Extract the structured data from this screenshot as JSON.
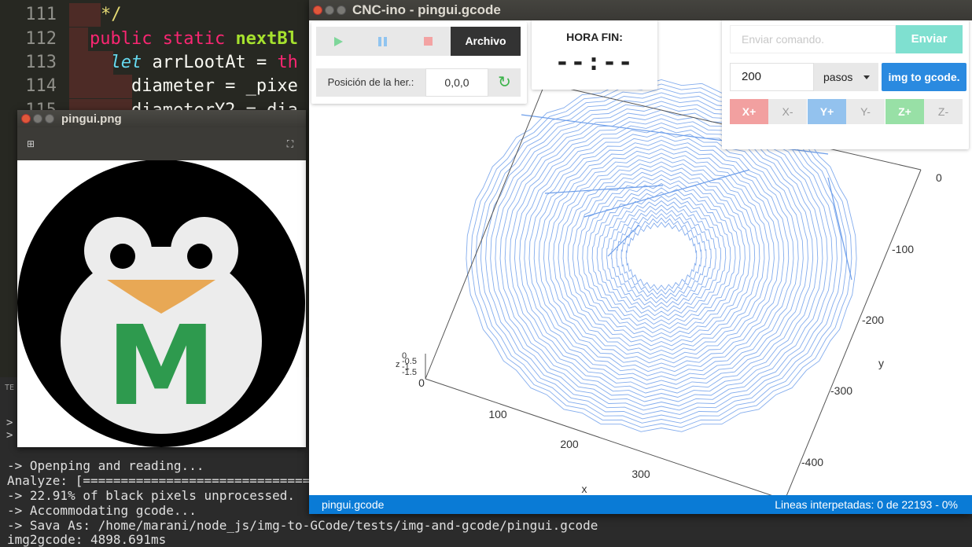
{
  "editor": {
    "lines": [
      {
        "num": "111",
        "parts": [
          {
            "t": "*/",
            "c": "cmt"
          }
        ]
      },
      {
        "num": "112",
        "parts": [
          {
            "t": "public static ",
            "c": "kw-red"
          },
          {
            "t": "nextBl",
            "c": "kw-green"
          }
        ]
      },
      {
        "num": "113",
        "parts": [
          {
            "t": "  ",
            "c": ""
          },
          {
            "t": "let",
            "c": "kw-blue"
          },
          {
            "t": " arrLootAt = ",
            "c": ""
          },
          {
            "t": "th",
            "c": "kw-red"
          }
        ]
      },
      {
        "num": "114",
        "parts": [
          {
            "t": "    diameter = _pixe",
            "c": ""
          }
        ]
      },
      {
        "num": "115",
        "parts": [
          {
            "t": "    diameterY2 = dia",
            "c": ""
          }
        ]
      }
    ]
  },
  "terminal": {
    "header": "TE",
    "prompts": [
      ">",
      ">"
    ],
    "lines": [
      "-> Openping and reading...",
      "Analyze: [==================================",
      "-> 22.91% of black pixels unprocessed.",
      "-> Accommodating gcode...",
      "-> Sava As: /home/marani/node_js/img-to-GCode/tests/img-and-gcode/pingui.gcode",
      "img2gcode: 4898.691ms"
    ]
  },
  "image_viewer": {
    "title": "pingui.png",
    "logo_letter": "M",
    "colors": {
      "ring": "#000000",
      "face": "#ececec",
      "beak": "#e8a855",
      "letter": "#2e9a4e"
    }
  },
  "cnc": {
    "title": "CNC-ino - pingui.gcode",
    "controls": {
      "archivo_label": "Archivo",
      "position_label": "Posición de la her.:",
      "position_value": "0,0,0"
    },
    "hora": {
      "label": "HORA FIN:",
      "value": "--:--"
    },
    "command": {
      "placeholder": "Enviar comando.",
      "send_label": "Enviar",
      "steps_value": "200",
      "units_selected": "pasos",
      "img2gcode_label": "img to gcode."
    },
    "jog": {
      "xp": "X+",
      "xm": "X-",
      "yp": "Y+",
      "ym": "Y-",
      "zp": "Z+",
      "zm": "Z-"
    },
    "plot": {
      "x_axis_label": "x",
      "y_axis_label": "y",
      "x_ticks": [
        "0",
        "100",
        "200",
        "300"
      ],
      "y_ticks": [
        "0",
        "-100",
        "-200",
        "-300",
        "-400"
      ],
      "z_label": "z",
      "z_ticks": [
        "0",
        "-0.5",
        "-1",
        "-1.5"
      ],
      "line_color": "#6d9eea"
    },
    "status": {
      "file": "pingui.gcode",
      "progress_text": "Lineas interpetadas: 0 de 22193 - 0%"
    }
  }
}
